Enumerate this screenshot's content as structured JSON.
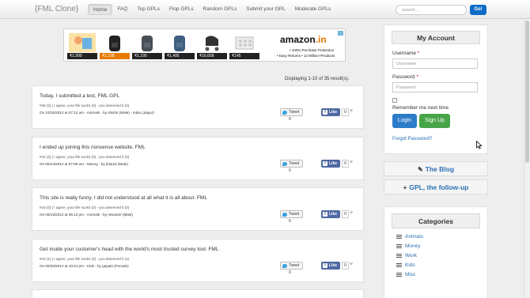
{
  "navbar": {
    "brand": "{FML Clone}",
    "items": [
      {
        "label": "Home",
        "active": true
      },
      {
        "label": "FAQ"
      },
      {
        "label": "Top GPLs"
      },
      {
        "label": "Flop GPLs"
      },
      {
        "label": "Random GPLs"
      },
      {
        "label": "Submit your GPL"
      },
      {
        "label": "Moderate GPLs"
      }
    ],
    "search_placeholder": "search...",
    "go_label": "Go!"
  },
  "ad": {
    "prices": [
      "₹1,999",
      "₹1,198",
      "₹1,190",
      "₹1,495",
      "₹16,608",
      "₹145"
    ],
    "logo_text": "amazon",
    "logo_suffix": ".in",
    "line1": "• 100% Purchase Protection",
    "line2": "• Easy Returns • 12 Million+Products",
    "corner": "i"
  },
  "displaying": "Displaying 1-10 of 35 result(s).",
  "posts": [
    {
      "text": "Today, I submitted a test, FML GPL",
      "votes": "#46 (0) | I agree, your life sucks (0) - you deserved it (0)",
      "meta": "On 10/15/2012 at 07:12 am - Animals - by shishir (Male) - India (Jaipur)",
      "tweet": "Tweet",
      "tweet_count": "0",
      "like": "Like",
      "like_count": "0"
    },
    {
      "text": "I ended up joining this nonsense website. FML",
      "votes": "#44 (0) | I agree, your life sucks (0) - you deserved it (0)",
      "meta": "On 06/14/2012 at 07:58 am - Money - by jhatool (Male)",
      "tweet": "Tweet",
      "tweet_count": "0",
      "like": "Like",
      "like_count": "0"
    },
    {
      "text": "This site is really funny. I did not understood at all what it is all about. FML",
      "votes": "#43 (0) | I agree, your life sucks (0) - you deserved it (0)",
      "meta": "On 06/13/2012 at 05:13 pm - Animals - by newuser (Male)",
      "tweet": "Tweet",
      "tweet_count": "0",
      "like": "Like",
      "like_count": "0"
    },
    {
      "text": "Get inside your customer's head with the world's most trusted survey tool. FML",
      "votes": "#42 (1) | I agree, your life sucks (2) - you deserved it (1)",
      "meta": "On 05/30/2012 at 10:44 pm - Kids - by gayatri (Female)",
      "tweet": "Tweet",
      "tweet_count": "0",
      "like": "Like",
      "like_count": "0"
    }
  ],
  "account": {
    "title": "My Account",
    "username_label": "Username",
    "username_placeholder": "Username",
    "password_label": "Password",
    "password_placeholder": "Password",
    "required_mark": "*",
    "remember": "Remember me next time",
    "login": "Login",
    "signup": "Sign Up",
    "forgot": "Forgot Password?"
  },
  "side_links": [
    {
      "icon": "✎",
      "label": "The Blog"
    },
    {
      "icon": "+",
      "label": "GPL, the follow-up"
    }
  ],
  "categories": {
    "title": "Categories",
    "items": [
      "Animals",
      "Money",
      "Work",
      "Kids",
      "Misc"
    ]
  }
}
